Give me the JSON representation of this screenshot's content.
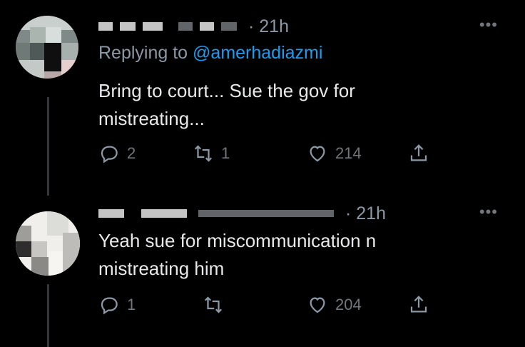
{
  "tweets": [
    {
      "timestamp": "· 21h",
      "replying_prefix": "Replying to ",
      "replying_handle": "@amerhadiazmi",
      "text": "Bring to court... Sue the gov for\nmistreating...",
      "replies": "2",
      "retweets": "1",
      "likes": "214"
    },
    {
      "timestamp": "· 21h",
      "text": "Yeah sue for miscommunication n\nmistreating him",
      "replies": "1",
      "retweets": "",
      "likes": "204"
    }
  ],
  "icons": {
    "more": "more-horizontal-icon",
    "reply": "reply-icon",
    "retweet": "retweet-icon",
    "like": "heart-icon",
    "share": "share-icon"
  },
  "colors": {
    "background": "#000000",
    "text": "#e7e9ea",
    "muted": "#71767b",
    "link": "#1d9bf0"
  }
}
